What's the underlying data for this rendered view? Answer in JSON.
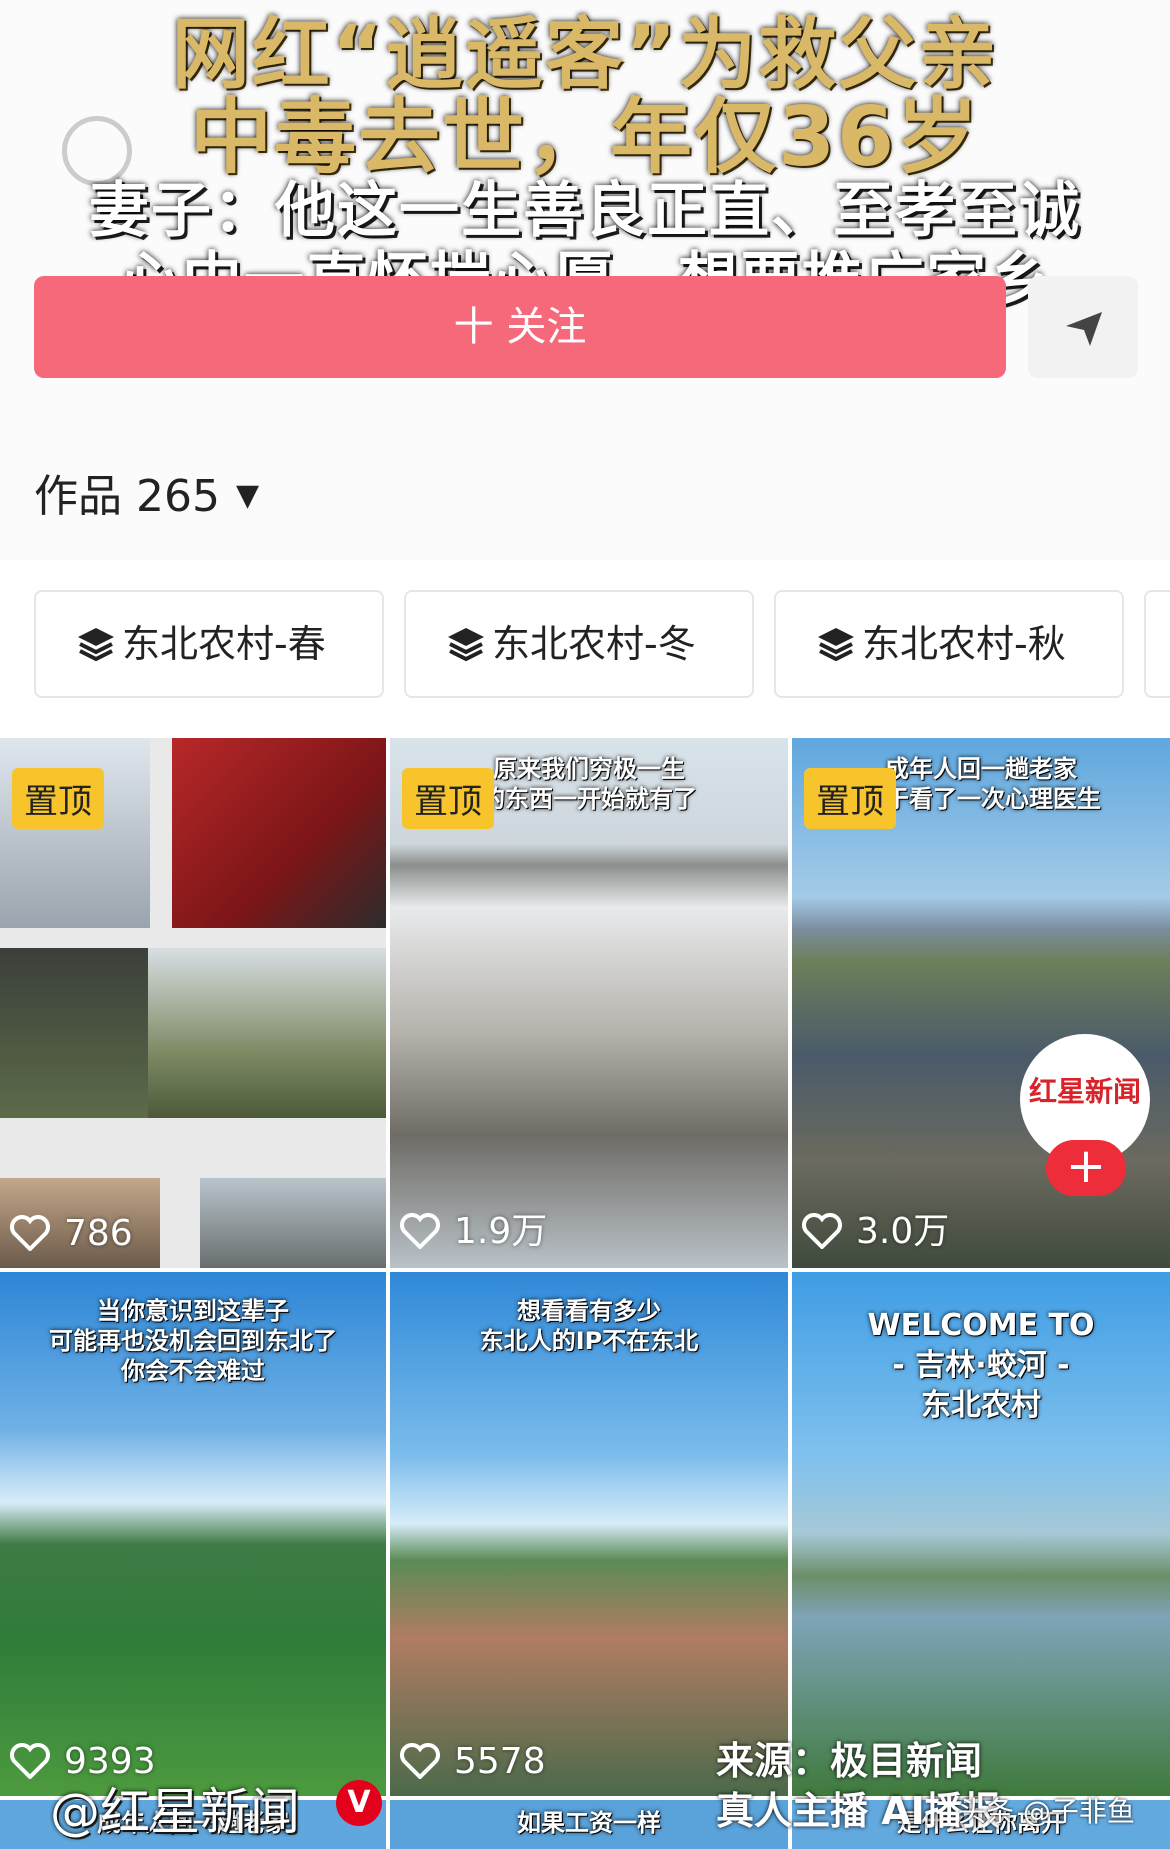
{
  "overlay": {
    "line1": "网红“逍遥客”为救父亲",
    "line2": "中毒去世，年仅36岁",
    "line3": "妻子：他这一生善良正直、至孝至诚",
    "line4": "心中一直怀揣心愿，想要推广家乡"
  },
  "profile": {
    "follow_label": "十 关注",
    "share_icon": "share-arrow-icon"
  },
  "works": {
    "label": "作品 265",
    "sort_arrow": "▼"
  },
  "collections": [
    {
      "label": "东北农村-春"
    },
    {
      "label": "东北农村-冬"
    },
    {
      "label": "东北农村-秋"
    }
  ],
  "videos": [
    {
      "pinned": "置顶",
      "likes": "786",
      "caption": ""
    },
    {
      "pinned": "置顶",
      "likes": "1.9万",
      "caption": "原来我们穷极一生\n的东西一开始就有了"
    },
    {
      "pinned": "置顶",
      "likes": "3.0万",
      "caption": "成年人回一趟老家\n等于看了一次心理医生"
    },
    {
      "pinned": "",
      "likes": "9393",
      "caption": "当你意识到这辈子\n可能再也没机会回到东北了\n你会不会难过"
    },
    {
      "pinned": "",
      "likes": "5578",
      "caption": "想看看有多少\n东北人的IP不在东北"
    },
    {
      "pinned": "",
      "likes": "",
      "caption": "WELCOME TO\n- 吉林·蛟河 -\n东北农村"
    }
  ],
  "next_row_captions": [
    "成年人回一趟老家",
    "如果工资一样",
    "是什么让你离开"
  ],
  "watermark": {
    "left": "@红星新闻",
    "right": "头条 @子非鱼",
    "source": "来源：极目新闻\n真人主播 AI播报",
    "logo_text": "红星新闻"
  },
  "colors": {
    "follow_bg": "#f5697a",
    "pin_bg": "#f7c52b",
    "headline_gold": "#d9b867"
  }
}
